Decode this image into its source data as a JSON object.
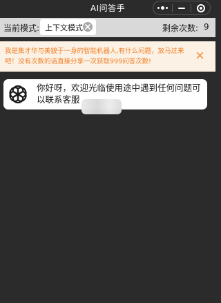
{
  "window": {
    "title": "AI问答手",
    "capsule": {
      "more_icon": "more-dots-icon",
      "minimize_icon": "minimize-icon",
      "close_icon": "target-close-icon"
    }
  },
  "mode_bar": {
    "label": "当前模式:",
    "selected_mode": "上下文模式",
    "clear_icon": "clear-x-icon",
    "remaining_label": "剩余次数:",
    "remaining_count": "9"
  },
  "notice": {
    "text": "我是集才华与美貌于一身的智能机器人,有什么问题，放马过来吧！没有次数的话直接分享一次获取999问答次数!",
    "close_icon": "close-icon",
    "color": "#ef7f26",
    "background": "#fcf1e5"
  },
  "messages": [
    {
      "avatar_icon": "openai-logo-icon",
      "text": "你好呀，欢迎光临使用途中遇到任何问题可以联系客服"
    }
  ],
  "colors": {
    "background": "#2b2b2b",
    "mode_bar": "#d9d9d9"
  }
}
